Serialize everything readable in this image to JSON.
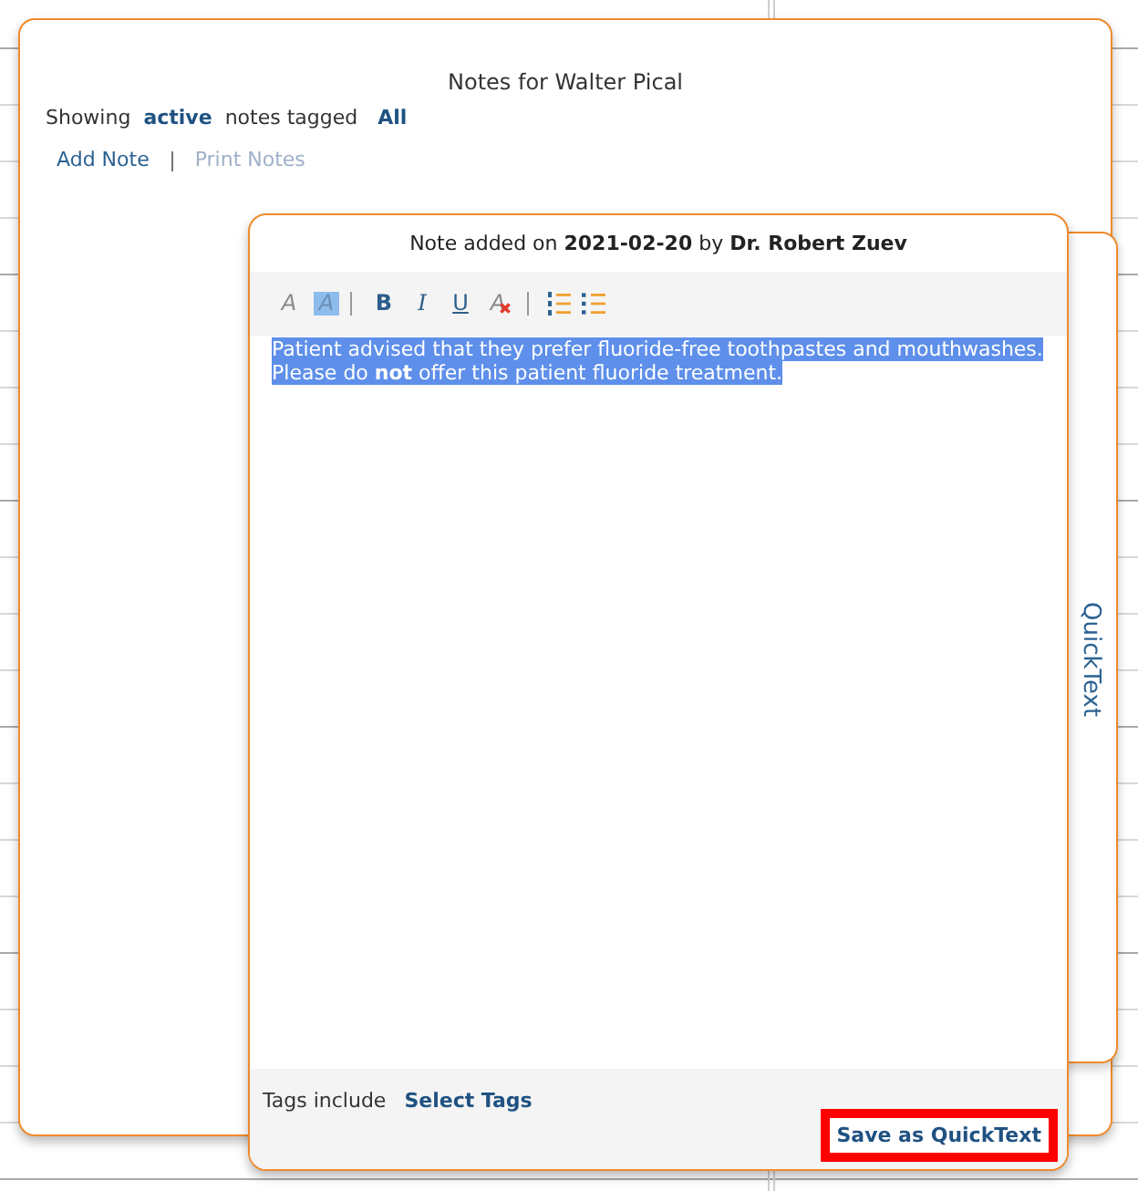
{
  "notes_dialog": {
    "title": "Notes for Walter Pical",
    "filter": {
      "prefix": "Showing",
      "status": "active",
      "middle": "notes tagged",
      "tag": "All"
    },
    "actions": [
      {
        "label": "Add Note",
        "disabled": false
      },
      {
        "label": "Print Notes",
        "disabled": true
      }
    ]
  },
  "note_editor": {
    "header": "Note added on **2021-02-20** by **Dr. Robert Zuev**",
    "toolbar_groups": [
      [
        {
          "kind": "font-color",
          "label": "A"
        },
        {
          "kind": "highlight",
          "label": "A"
        }
      ],
      [
        {
          "kind": "bold",
          "label": "B"
        },
        {
          "kind": "italic",
          "label": "I"
        },
        {
          "kind": "underline",
          "label": "U"
        },
        {
          "kind": "clear-format",
          "label": "A"
        }
      ],
      [
        {
          "kind": "ordered-list"
        },
        {
          "kind": "bullet-list"
        }
      ]
    ],
    "body": {
      "selected": true,
      "lines": [
        "Patient advised that they prefer fluoride-free toothpastes and mouthwashes.",
        "Please do **not** offer this patient fluoride treatment."
      ]
    },
    "tags": {
      "label": "Tags include",
      "link": "Select Tags"
    },
    "save_button": {
      "label": "Save as QuickText",
      "highlighted": true
    }
  },
  "side_tab": {
    "label": "QuickText"
  }
}
